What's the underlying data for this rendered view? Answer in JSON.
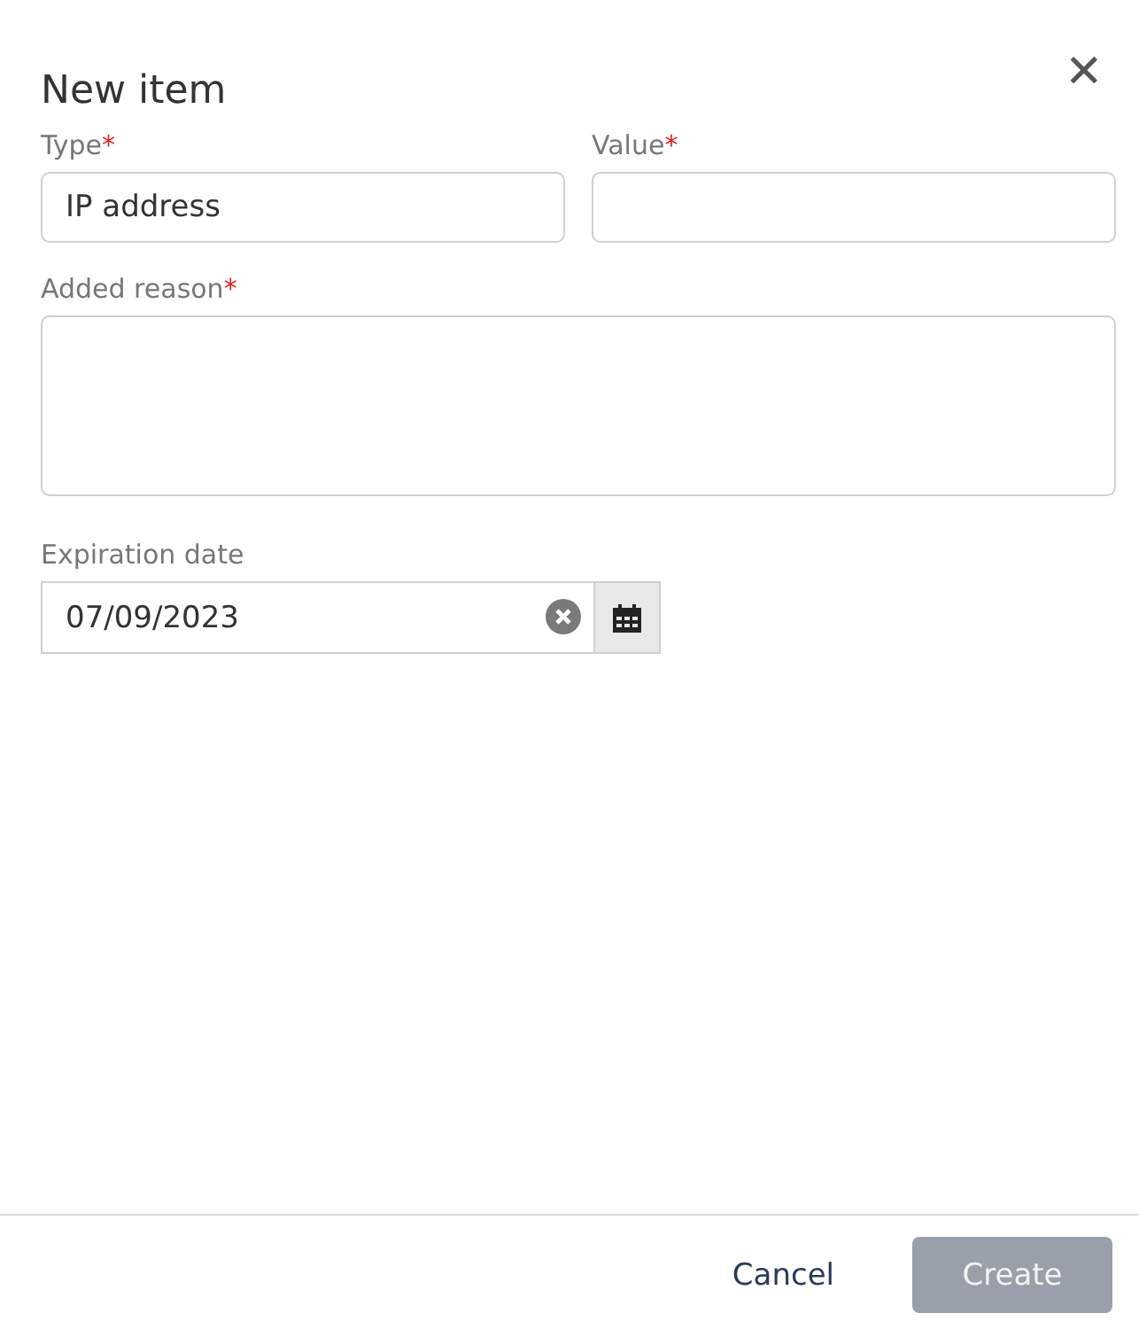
{
  "dialog": {
    "title": "New item",
    "close": "✕"
  },
  "fields": [
    {
      "kind": "input",
      "label": "Type",
      "required_mark": "*",
      "value": "IP address"
    },
    {
      "kind": "input",
      "label": "Value",
      "required_mark": "*"
    },
    {
      "kind": "textarea",
      "label": "Added reason",
      "required_mark": "*"
    },
    {
      "kind": "date",
      "label": "Expiration date",
      "value": "07/09/2023"
    }
  ],
  "buttons": [
    {
      "kind": "link",
      "label": "Cancel",
      "disabled": false
    },
    {
      "kind": "primary",
      "label": "Create",
      "disabled": true
    }
  ]
}
